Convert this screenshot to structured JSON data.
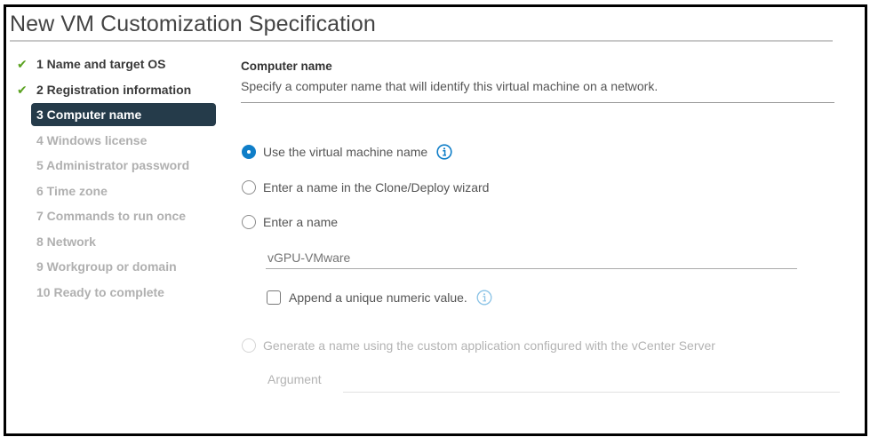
{
  "dialog": {
    "title": "New VM Customization Specification"
  },
  "steps": [
    {
      "label": "1 Name and target OS",
      "state": "done",
      "icon": "check-icon"
    },
    {
      "label": "2 Registration information",
      "state": "done",
      "icon": "check-icon"
    },
    {
      "label": "3 Computer name",
      "state": "active"
    },
    {
      "label": "4 Windows license",
      "state": "pending"
    },
    {
      "label": "5 Administrator password",
      "state": "pending"
    },
    {
      "label": "6 Time zone",
      "state": "pending"
    },
    {
      "label": "7 Commands to run once",
      "state": "pending"
    },
    {
      "label": "8 Network",
      "state": "pending"
    },
    {
      "label": "9 Workgroup or domain",
      "state": "pending"
    },
    {
      "label": "10 Ready to complete",
      "state": "pending"
    }
  ],
  "section": {
    "title": "Computer name",
    "description": "Specify a computer name that will identify this virtual machine on a network."
  },
  "options": {
    "use_vm_name": {
      "label": "Use the virtual machine name",
      "selected": true,
      "icon": "info-icon"
    },
    "clone_wizard": {
      "label": "Enter a name in the Clone/Deploy wizard",
      "selected": false
    },
    "enter_name": {
      "label": "Enter a name",
      "selected": false
    },
    "custom_app": {
      "label": "Generate a name using the custom application configured with the vCenter Server",
      "selected": false,
      "disabled": true
    }
  },
  "name_input": {
    "placeholder": "vGPU-VMware",
    "value": ""
  },
  "append_numeric": {
    "label": "Append a unique numeric value.",
    "checked": false,
    "icon": "info-icon"
  },
  "argument": {
    "label": "Argument",
    "value": ""
  },
  "colors": {
    "accent": "#0f7ec8",
    "active_step_bg": "#253b4a",
    "check_green": "#5aa220"
  }
}
